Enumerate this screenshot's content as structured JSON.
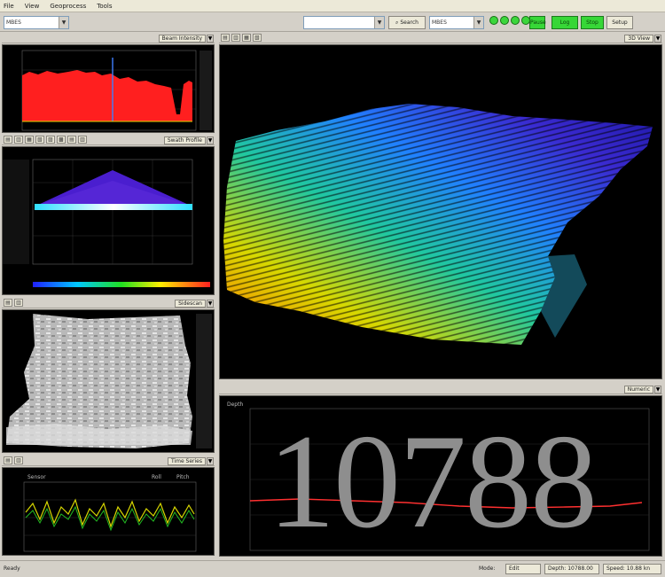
{
  "menu": [
    "File",
    "View",
    "Geoprocess",
    "Tools"
  ],
  "toolbar": {
    "left_combo": "MBES",
    "mid_combo": "",
    "search_label": "Search",
    "right_combo": "MBES",
    "buttons": [
      "Pause",
      "Log",
      "Stop",
      "Setup"
    ],
    "indicator_color": "#3cd63c",
    "button_color": "#37d737"
  },
  "panels": {
    "survey_status": {
      "label": "Beam Intensity"
    },
    "swath": {
      "label": "Swath Profile"
    },
    "sidescan": {
      "label": "Sidescan"
    },
    "time_series": {
      "label": "Time Series",
      "legend_left": "Sensor",
      "legend_right_a": "Roll",
      "legend_right_b": "Pitch"
    },
    "view_3d": {
      "label": "3D View"
    },
    "numeric": {
      "label": "Numeric",
      "caption": "Depth",
      "value": "10788"
    }
  },
  "status": {
    "left": "Ready",
    "mode_label": "Mode:",
    "mode_value": "Edit",
    "depth": "Depth: 10788.00",
    "speed": "Speed: 10.88 kn"
  },
  "colors": {
    "intensity_fill": "#ff1f1f",
    "spike_line": "#3f7fff",
    "trace_a": "#d8d800",
    "trace_b": "#22bb22",
    "trace_red": "#ff3030",
    "value_text": "#8e8e8e"
  }
}
